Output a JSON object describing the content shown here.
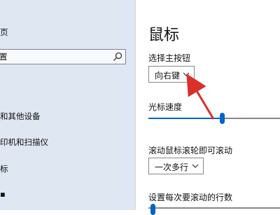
{
  "sidebar": {
    "items": [
      {
        "label": "页"
      },
      {
        "label": "鼠标"
      },
      {
        "label": "和其他设备"
      },
      {
        "label": "印机和扫描仪"
      },
      {
        "label": "标"
      }
    ],
    "search": {
      "value": "置",
      "placeholder": ""
    }
  },
  "main": {
    "title": "鼠标",
    "primary_button": {
      "label": "选择主按钮",
      "value": "向右键"
    },
    "cursor_speed": {
      "label": "光标速度",
      "level": 0.56
    },
    "scroll": {
      "label": "滚动鼠标滚轮即可滚动",
      "value": "一次多行"
    },
    "lines": {
      "label": "设置每次要滚动的行数"
    }
  },
  "colors": {
    "accent": "#0063c8",
    "sidebar_bg": "#dfe7f2",
    "arrow_red": "#d9302b"
  }
}
